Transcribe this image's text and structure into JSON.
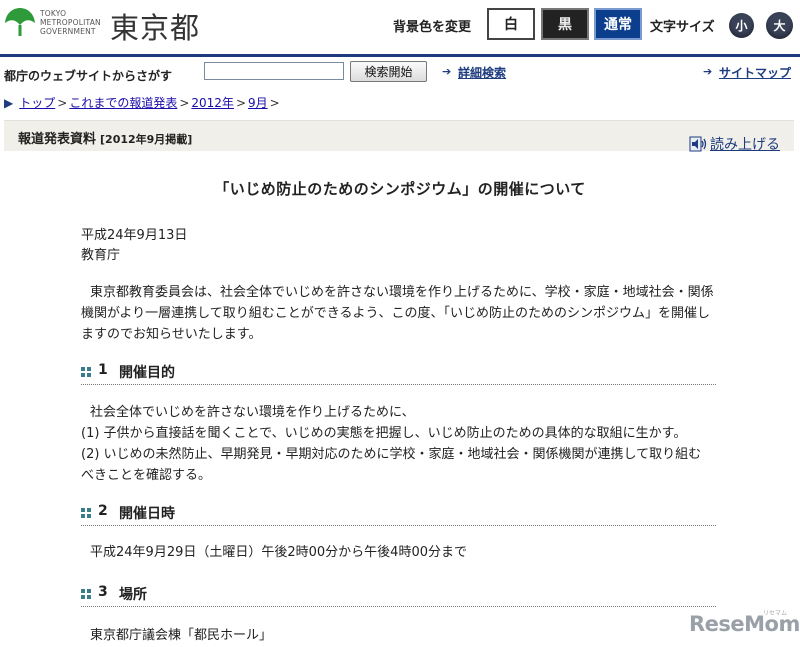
{
  "header": {
    "logo_en_line1": "TOKYO",
    "logo_en_line2": "METROPOLITAN",
    "logo_en_line3": "GOVERNMENT",
    "logo_ja": "東京都",
    "bg_label": "背景色を変更",
    "bg_white": "白",
    "bg_black": "黒",
    "bg_normal": "通常",
    "font_label": "文字サイズ",
    "font_small": "小",
    "font_large": "大"
  },
  "search": {
    "label": "都庁のウェブサイトからさがす",
    "input_value": "",
    "button": "検索開始",
    "advanced": "詳細検索",
    "sitemap": "サイトマップ"
  },
  "breadcrumb": {
    "items": [
      "トップ",
      "これまでの報道発表",
      "2012年",
      "9月"
    ],
    "sep": ">"
  },
  "band": {
    "title": "報道発表資料",
    "subtitle": "[2012年9月掲載]",
    "read_aloud": "読み上げる"
  },
  "article": {
    "title": "「いじめ防止のためのシンポジウム」の開催について",
    "date": "平成24年9月13日",
    "dept": "教育庁",
    "intro": "東京都教育委員会は、社会全体でいじめを許さない環境を作り上げるために、学校・家庭・地域社会・関係機関がより一層連携して取り組むことができるよう、この度、「いじめ防止のためのシンポジウム」を開催しますのでお知らせいたします。",
    "sections": [
      {
        "num": "1",
        "heading": "開催目的"
      },
      {
        "num": "2",
        "heading": "開催日時"
      },
      {
        "num": "3",
        "heading": "場所"
      }
    ],
    "purpose_lines": [
      "社会全体でいじめを許さない環境を作り上げるために、",
      "(1) 子供から直接話を聞くことで、いじめの実態を把握し、いじめ防止のための具体的な取組に生かす。",
      "(2) いじめの未然防止、早期発見・早期対応のために学校・家庭・地域社会・関係機関が連携して取り組むべきことを確認する。"
    ],
    "schedule": "平成24年9月29日（土曜日）午後2時00分から午後4時00分まで",
    "venue": "東京都庁議会棟「都民ホール」"
  },
  "watermark": {
    "text": "ReseMom",
    "small": "リセマム"
  },
  "colors": {
    "brand_navy": "#1d3b7e",
    "logo_green": "#2e9a3a",
    "band_bg": "#f1efe9",
    "section_icon": "#3b7c8c"
  }
}
